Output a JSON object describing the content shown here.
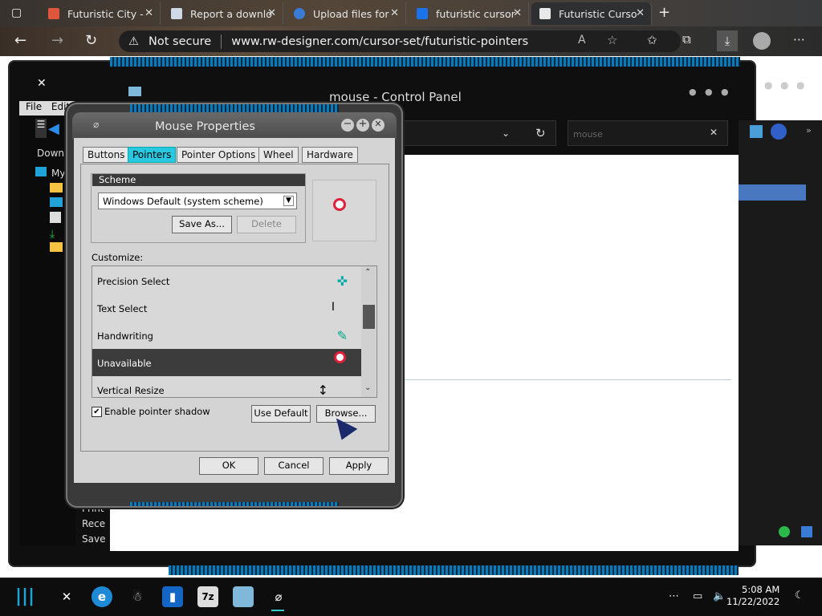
{
  "browser": {
    "tabs": [
      {
        "label": "Futuristic City - ",
        "icon": "page-icon",
        "color": "#e0563c"
      },
      {
        "label": "Report a downlo",
        "icon": "page-icon",
        "color": "#cfd8e6"
      },
      {
        "label": "Upload files for",
        "icon": "cloud-icon",
        "color": "#3a7bd5"
      },
      {
        "label": "futuristic cursor",
        "icon": "search-icon",
        "color": "#1a73e8"
      },
      {
        "label": "Futuristic Curso",
        "icon": "page-icon",
        "color": "#e8e8e8"
      }
    ],
    "security": "Not secure",
    "url": "www.rw-designer.com/cursor-set/futuristic-pointers"
  },
  "control_panel": {
    "title": "mouse - Control Panel",
    "menu": [
      "File",
      "Edit"
    ],
    "search_value": "mouse",
    "tree": [
      "Downl",
      "My",
      "Print",
      "Rece",
      "Save"
    ]
  },
  "dialog": {
    "title": "Mouse Properties",
    "tabs": [
      "Buttons",
      "Pointers",
      "Pointer Options",
      "Wheel",
      "Hardware"
    ],
    "selected_tab": "Pointers",
    "scheme": {
      "header": "Scheme",
      "value": "Windows Default (system scheme)",
      "save_as": "Save As...",
      "delete": "Delete"
    },
    "customize_label": "Customize:",
    "rows": [
      {
        "label": "Precision Select",
        "icon": "crosshair-icon",
        "glyph": "✜"
      },
      {
        "label": "Text Select",
        "icon": "ibeam-icon",
        "glyph": "I"
      },
      {
        "label": "Handwriting",
        "icon": "pen-icon",
        "glyph": "✎"
      },
      {
        "label": "Unavailable",
        "icon": "unavailable-icon",
        "glyph": "⃠"
      },
      {
        "label": "Vertical Resize",
        "icon": "vertical-resize-icon",
        "glyph": "↕"
      }
    ],
    "selected_row": "Unavailable",
    "shadow_label": "Enable pointer shadow",
    "shadow_checked": true,
    "use_default": "Use Default",
    "browse": "Browse...",
    "ok": "OK",
    "cancel": "Cancel",
    "apply": "Apply"
  },
  "taskbar": {
    "time": "5:08 AM",
    "date": "11/22/2022"
  },
  "colors": {
    "accent": "#28c8e0",
    "selected_row": "#3c3c3c"
  }
}
